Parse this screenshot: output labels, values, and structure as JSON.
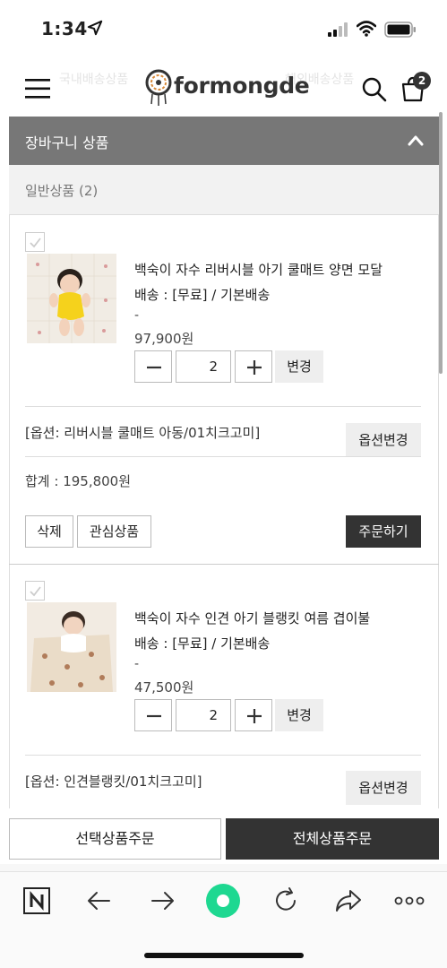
{
  "status_bar": {
    "time": "1:34"
  },
  "header": {
    "logo_text": "formongde",
    "ghost_left": "국내배송상품",
    "ghost_right": "해외배송상품",
    "cart_count": "2"
  },
  "cart": {
    "section_title": "장바구니 상품",
    "subsection_label": "일반상품 (2)",
    "items": [
      {
        "name": "백숙이 자수 리버시블 아기 쿨매트 양면 모달",
        "shipping": "배송 : [무료] / 기본배송",
        "dash": "-",
        "price": "97,900원",
        "quantity": "2",
        "change_label": "변경",
        "option_text": "[옵션: 리버시블 쿨매트 아동/01치크고미]",
        "option_change_label": "옵션변경",
        "total": "합계 : 195,800원",
        "delete_label": "삭제",
        "wishlist_label": "관심상품",
        "order_label": "주문하기"
      },
      {
        "name": "백숙이 자수 인견 아기 블랭킷 여름 겹이불",
        "shipping": "배송 : [무료] / 기본배송",
        "dash": "-",
        "price": "47,500원",
        "quantity": "2",
        "change_label": "변경",
        "option_text": "[옵션: 인견블랭킷/01치크고미]",
        "option_change_label": "옵션변경"
      }
    ]
  },
  "bottom_bar": {
    "selected_order": "선택상품주문",
    "all_order": "전체상품주문"
  },
  "browser_toolbar": {
    "icons": [
      "naver-n-icon",
      "back-arrow-icon",
      "forward-arrow-icon",
      "home-green-circle-icon",
      "reload-icon",
      "share-icon",
      "more-icon"
    ],
    "accent_color": "#1ed891"
  }
}
